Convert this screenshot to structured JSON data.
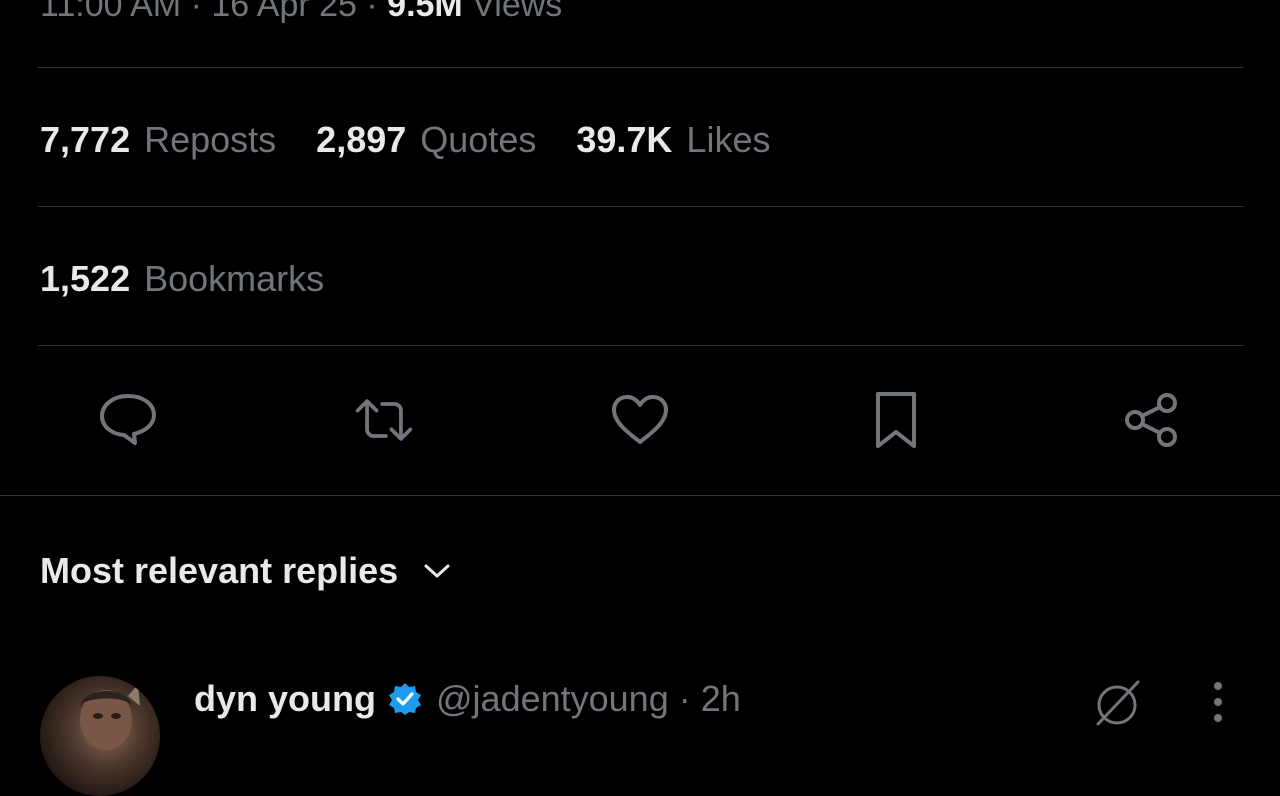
{
  "post_meta": {
    "time": "11:00 AM",
    "separator": "·",
    "date": "16 Apr 25",
    "views_count": "9.5M",
    "views_label": "Views"
  },
  "stats": {
    "reposts": {
      "count": "7,772",
      "label": "Reposts"
    },
    "quotes": {
      "count": "2,897",
      "label": "Quotes"
    },
    "likes": {
      "count": "39.7K",
      "label": "Likes"
    },
    "bookmarks": {
      "count": "1,522",
      "label": "Bookmarks"
    }
  },
  "actions": [
    "reply-icon",
    "repost-icon",
    "like-icon",
    "bookmark-icon",
    "share-icon"
  ],
  "replies": {
    "sort_label": "Most relevant replies",
    "first_reply": {
      "name": "dyn young",
      "handle": "@jadentyoung",
      "time": "· 2h"
    }
  },
  "colors": {
    "background": "#000000",
    "text_primary": "#e7e9ea",
    "text_secondary": "#71767b",
    "divider": "#2f3336",
    "verified_badge": "#1d9bf0"
  }
}
